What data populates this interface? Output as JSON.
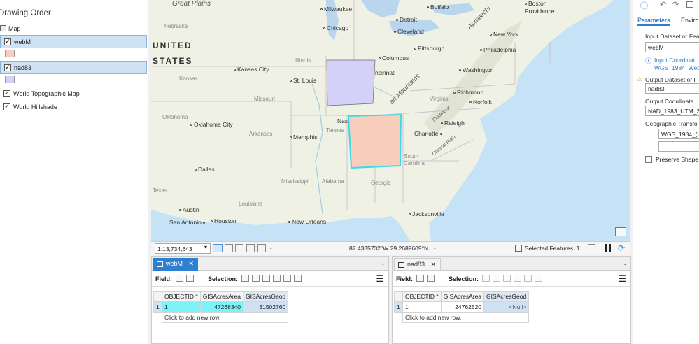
{
  "toc": {
    "title": "Drawing Order",
    "items": [
      {
        "label": "Map",
        "type": "map"
      },
      {
        "label": "webM",
        "checked": "✓",
        "selected": true,
        "swatch": "#f7cdbb"
      },
      {
        "label": "nad83",
        "checked": "✓",
        "selected": true,
        "swatch": "#d3d1f7"
      },
      {
        "label": "World Topographic Map",
        "checked": "✓"
      },
      {
        "label": "World Hillshade",
        "checked": "✓"
      }
    ]
  },
  "map": {
    "labels": {
      "great_plains": "Great Plains",
      "united": "UNITED",
      "states": "STATES",
      "nebraska": "Nebraska",
      "kansas": "Kansas",
      "kansas_city": "Kansas City",
      "st_louis": "St. Louis",
      "illinois": "Illinois",
      "missouri": "Missouri",
      "oklahoma": "Oklahoma",
      "oklahoma_city": "Oklahoma City",
      "arkansas": "Arkansas",
      "memphis": "Memphis",
      "dallas": "Dallas",
      "texas": "Texas",
      "austin": "Austin",
      "san_antonio": "San Antonio",
      "houston": "Houston",
      "louisiana": "Louisiana",
      "new_orleans": "New Orleans",
      "mississippi": "Mississippi",
      "alabama": "Alabama",
      "georgia": "Georgia",
      "jacksonville": "Jacksonville",
      "south_carolina": "South\nCarolina",
      "charlotte": "Charlotte",
      "raleigh": "Raleigh",
      "norfolk": "Norfolk",
      "richmond": "Richmond",
      "virginia": "Virginia",
      "washington": "Washington",
      "philadelphia": "Philadelphia",
      "new_york": "New York",
      "pittsburgh": "Pittsburgh",
      "columbus": "Columbus",
      "cincinnati": "ncinnati",
      "cleveland": "Cleveland",
      "detroit": "Detroit",
      "chicago": "Chicago",
      "milwaukee": "Milwaukee",
      "buffalo": "Buffalo",
      "boston": "Boston",
      "providence": "Providence",
      "appalachian": "Appalachi",
      "an_mountains": "an Mountains",
      "nas": "Nas",
      "tennes": "Tennes",
      "piedmont": "Piedmont",
      "coastal_plain": "Coastal Plain"
    },
    "polygons": {
      "nad83_color": "#d3d1f7",
      "webm_color": "#f7cdbb",
      "webm_outline": "#3fd8e8"
    }
  },
  "mapstatus": {
    "scale": "1:13,734,643",
    "coords": "87.4335732°W 29.2689609°N",
    "selected": "Selected Features: 1"
  },
  "gp": {
    "tab_parameters": "Parameters",
    "tab_environments": "Enviro",
    "input_label": "Input Dataset or Fea",
    "input_value": "webM",
    "info_line1": "Input Coordinat",
    "info_line2": "WGS_1984_Web_",
    "output_label": "Output Dataset or F",
    "output_value": "nad83",
    "outcs_label": "Output Coordinate",
    "outcs_value": "NAD_1983_UTM_Zo",
    "geotrans_label": "Geographic Transfo",
    "geotrans_value": "WGS_1984_(IT",
    "preserve_label": "Preserve Shape"
  },
  "table_webm": {
    "tab_label": "webM",
    "field_label": "Field:",
    "selection_label": "Selection:",
    "columns": [
      "OBJECTID *",
      "GISAcresArea",
      "GISAcresGeod"
    ],
    "rows": [
      [
        "1",
        "47268340",
        "31502760"
      ]
    ],
    "row_num": "1",
    "add_row": "Click to add new row."
  },
  "table_nad83": {
    "tab_label": "nad83",
    "field_label": "Field:",
    "selection_label": "Selection:",
    "columns": [
      "OBJECTID *",
      "GISAcresArea",
      "GISAcresGeod"
    ],
    "rows": [
      [
        "1",
        "24762520",
        "<Null>"
      ]
    ],
    "row_num": "1",
    "add_row": "Click to add new row."
  }
}
